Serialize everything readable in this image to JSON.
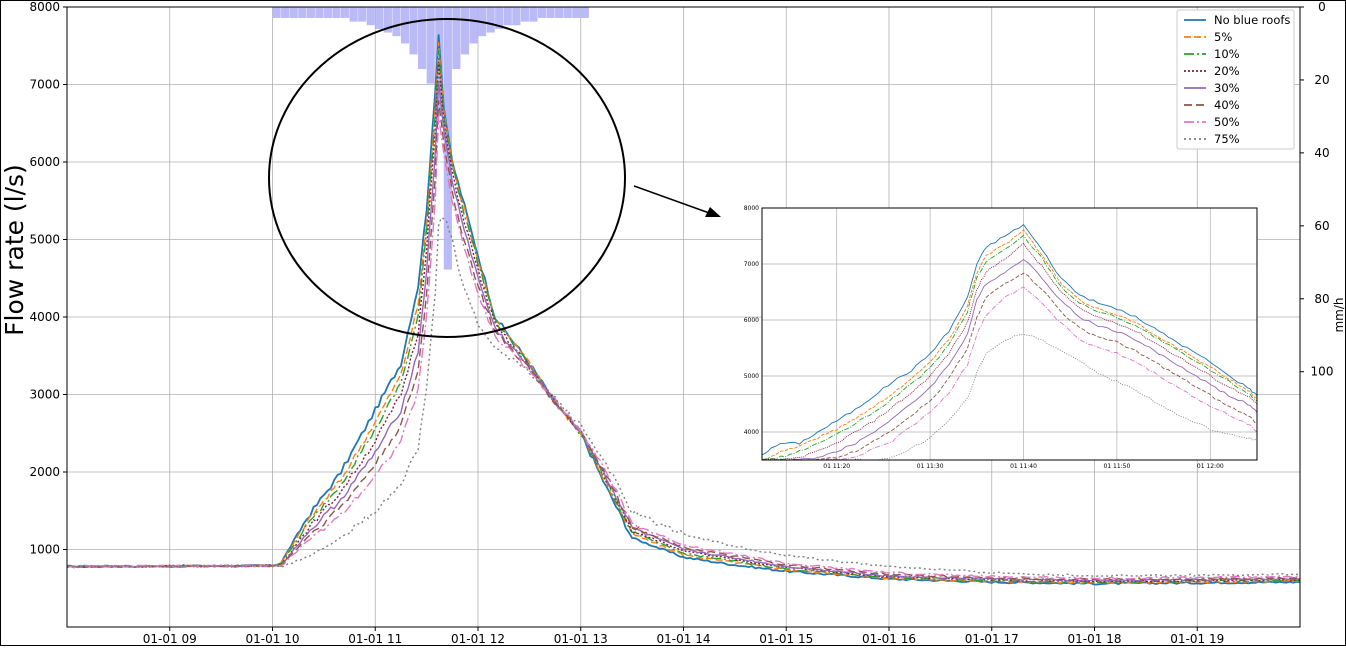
{
  "chart_data": [
    {
      "type": "line",
      "ylabel": "Flow rate (l/s)",
      "y2label": "mm/h",
      "ylim": [
        0,
        8000
      ],
      "xlim": [
        "01-01 08:00",
        "01-01 20:00"
      ],
      "x_ticks": [
        "01-01 09",
        "01-01 10",
        "01-01 11",
        "01-01 12",
        "01-01 13",
        "01-01 14",
        "01-01 15",
        "01-01 16",
        "01-01 17",
        "01-01 18",
        "01-01 19"
      ],
      "y_ticks": [
        1000,
        2000,
        3000,
        4000,
        5000,
        6000,
        7000,
        8000
      ],
      "y2_ticks": [
        0,
        20,
        40,
        60,
        80,
        100
      ],
      "y2lim": [
        0,
        170
      ],
      "y2_inverted": true,
      "grid": true,
      "legend_position": "top-right",
      "x": [
        "08:00",
        "10:00",
        "10:05",
        "10:20",
        "10:40",
        "11:00",
        "11:15",
        "11:25",
        "11:30",
        "11:35",
        "11:37",
        "11:40",
        "11:45",
        "11:50",
        "12:00",
        "12:10",
        "12:30",
        "12:45",
        "13:00",
        "13:15",
        "13:30",
        "14:00",
        "14:30",
        "15:00",
        "16:00",
        "17:00",
        "18:00",
        "19:00",
        "20:00"
      ],
      "series": [
        {
          "name": "No blue roofs",
          "color": "#1f77b4",
          "dash": "",
          "values": [
            780,
            790,
            830,
            1400,
            2000,
            2800,
            3400,
            4400,
            5400,
            6900,
            7650,
            6700,
            6000,
            5600,
            4800,
            4000,
            3400,
            2900,
            2500,
            1800,
            1150,
            900,
            800,
            720,
            620,
            580,
            560,
            570,
            580
          ]
        },
        {
          "name": "5%",
          "color": "#ff7f0e",
          "dash": "7,3",
          "values": [
            780,
            790,
            820,
            1350,
            1900,
            2650,
            3250,
            4150,
            5200,
            6700,
            7550,
            6650,
            6000,
            5550,
            4750,
            3970,
            3400,
            2900,
            2500,
            1850,
            1200,
            930,
            830,
            740,
            630,
            590,
            570,
            580,
            590
          ]
        },
        {
          "name": "10%",
          "color": "#2ca02c",
          "dash": "10,3,2,3",
          "values": [
            780,
            790,
            810,
            1300,
            1850,
            2550,
            3150,
            4000,
            5100,
            6600,
            7450,
            6600,
            5950,
            5500,
            4700,
            3950,
            3380,
            2900,
            2500,
            1870,
            1220,
            950,
            850,
            750,
            640,
            600,
            580,
            590,
            600
          ]
        },
        {
          "name": "20%",
          "color": "#8c1a3c",
          "dash": "2,2",
          "values": [
            780,
            790,
            800,
            1250,
            1750,
            2400,
            3000,
            3800,
            4900,
            6400,
            7300,
            6500,
            5850,
            5400,
            4600,
            3900,
            3350,
            2900,
            2520,
            1900,
            1250,
            980,
            870,
            770,
            650,
            610,
            590,
            600,
            610
          ]
        },
        {
          "name": "30%",
          "color": "#9467bd",
          "dash": "",
          "values": [
            780,
            790,
            795,
            1200,
            1650,
            2250,
            2800,
            3550,
            4600,
            6100,
            7050,
            6400,
            5750,
            5300,
            4500,
            3850,
            3350,
            2900,
            2520,
            1930,
            1280,
            1000,
            890,
            780,
            660,
            620,
            600,
            610,
            620
          ]
        },
        {
          "name": "40%",
          "color": "#8c564b",
          "dash": "8,4",
          "values": [
            780,
            790,
            790,
            1150,
            1550,
            2100,
            2600,
            3300,
            4300,
            5800,
            6800,
            6250,
            5600,
            5150,
            4400,
            3800,
            3330,
            2900,
            2530,
            1960,
            1300,
            1030,
            910,
            800,
            680,
            630,
            610,
            620,
            630
          ]
        },
        {
          "name": "50%",
          "color": "#e377c2",
          "dash": "10,3,2,3",
          "values": [
            780,
            790,
            785,
            1100,
            1450,
            1950,
            2400,
            3050,
            4000,
            5500,
            6600,
            6100,
            5500,
            5050,
            4300,
            3750,
            3320,
            2920,
            2550,
            2000,
            1330,
            1060,
            940,
            820,
            700,
            650,
            630,
            640,
            650
          ]
        },
        {
          "name": "75%",
          "color": "#7f7f7f",
          "dash": "2,3",
          "values": [
            780,
            790,
            780,
            900,
            1150,
            1500,
            1850,
            2300,
            3100,
            4300,
            5200,
            5300,
            5000,
            4500,
            3900,
            3600,
            3300,
            2950,
            2600,
            2100,
            1480,
            1200,
            1040,
            920,
            780,
            700,
            660,
            670,
            680
          ]
        }
      ],
      "rain_mm_h": {
        "x": [
          "10:00",
          "10:05",
          "10:10",
          "10:15",
          "10:20",
          "10:25",
          "10:30",
          "10:35",
          "10:40",
          "10:45",
          "10:50",
          "10:55",
          "11:00",
          "11:05",
          "11:10",
          "11:15",
          "11:20",
          "11:25",
          "11:30",
          "11:35",
          "11:40",
          "11:45",
          "11:50",
          "11:55",
          "12:00",
          "12:05",
          "12:10",
          "12:15",
          "12:20",
          "12:25",
          "12:30",
          "12:35",
          "12:40",
          "12:45",
          "12:50",
          "12:55",
          "13:00"
        ],
        "values": [
          3,
          3,
          3,
          3,
          3,
          3,
          3,
          3,
          3,
          4,
          4,
          5,
          6,
          7,
          8,
          10,
          13,
          17,
          21,
          30,
          72,
          17,
          13,
          10,
          8,
          7,
          6,
          5,
          5,
          4,
          4,
          3,
          3,
          3,
          3,
          3,
          3
        ]
      }
    },
    {
      "type": "line",
      "title": "",
      "xlim": [
        "11:12",
        "12:05"
      ],
      "ylim": [
        3500,
        8000
      ],
      "x_ticks": [
        "01 11:20",
        "01 11:30",
        "01 11:40",
        "01 11:50",
        "01 12:00"
      ],
      "y_ticks": [
        4000,
        5000,
        6000,
        7000,
        8000
      ],
      "grid": true,
      "x": [
        "11:12",
        "11:14",
        "11:16",
        "11:18",
        "11:20",
        "11:22",
        "11:24",
        "11:26",
        "11:28",
        "11:30",
        "11:32",
        "11:34",
        "11:35",
        "11:36",
        "11:38",
        "11:40",
        "11:42",
        "11:44",
        "11:46",
        "11:48",
        "11:50",
        "11:52",
        "11:54",
        "11:56",
        "11:58",
        "12:00",
        "12:02",
        "12:04",
        "12:05"
      ],
      "series": [
        {
          "name": "No blue roofs",
          "color": "#1f77b4",
          "dash": "",
          "values": [
            3600,
            3800,
            3800,
            4000,
            4200,
            4400,
            4650,
            4900,
            5100,
            5400,
            5800,
            6400,
            7000,
            7300,
            7500,
            7700,
            7250,
            6750,
            6450,
            6300,
            6200,
            6050,
            5850,
            5650,
            5450,
            5250,
            5000,
            4800,
            4650
          ]
        },
        {
          "name": "5%",
          "color": "#ff7f0e",
          "dash": "7,3",
          "values": [
            3500,
            3650,
            3750,
            3900,
            4050,
            4250,
            4450,
            4700,
            4950,
            5250,
            5650,
            6250,
            6850,
            7150,
            7350,
            7600,
            7150,
            6650,
            6350,
            6200,
            6100,
            5950,
            5750,
            5550,
            5350,
            5150,
            4950,
            4750,
            4600
          ]
        },
        {
          "name": "10%",
          "color": "#2ca02c",
          "dash": "10,3,2,3",
          "values": [
            3500,
            3550,
            3650,
            3800,
            3950,
            4150,
            4350,
            4600,
            4850,
            5150,
            5550,
            6150,
            6750,
            7050,
            7250,
            7500,
            7100,
            6600,
            6300,
            6150,
            6050,
            5900,
            5700,
            5500,
            5300,
            5100,
            4900,
            4700,
            4550
          ]
        },
        {
          "name": "20%",
          "color": "#8c1a3c",
          "dash": "2,2",
          "values": [
            3500,
            3500,
            3550,
            3650,
            3800,
            4000,
            4200,
            4450,
            4700,
            5000,
            5400,
            5950,
            6550,
            6850,
            7100,
            7350,
            6950,
            6500,
            6200,
            6050,
            5950,
            5800,
            5600,
            5400,
            5200,
            5000,
            4800,
            4650,
            4500
          ]
        },
        {
          "name": "30%",
          "color": "#9467bd",
          "dash": "",
          "values": [
            3500,
            3500,
            3500,
            3550,
            3650,
            3800,
            4000,
            4250,
            4500,
            4800,
            5200,
            5750,
            6350,
            6650,
            6850,
            7100,
            6750,
            6350,
            6050,
            5900,
            5800,
            5650,
            5450,
            5250,
            5050,
            4850,
            4650,
            4500,
            4350
          ]
        },
        {
          "name": "40%",
          "color": "#8c564b",
          "dash": "8,4",
          "values": [
            3500,
            3500,
            3500,
            3500,
            3550,
            3650,
            3850,
            4050,
            4300,
            4550,
            4950,
            5500,
            6050,
            6400,
            6650,
            6850,
            6550,
            6150,
            5850,
            5700,
            5600,
            5450,
            5250,
            5050,
            4850,
            4650,
            4450,
            4300,
            4150
          ]
        },
        {
          "name": "50%",
          "color": "#e377c2",
          "dash": "10,3,2,3",
          "values": [
            3500,
            3500,
            3500,
            3500,
            3500,
            3550,
            3700,
            3850,
            4100,
            4350,
            4700,
            5200,
            5750,
            6100,
            6400,
            6600,
            6300,
            5950,
            5650,
            5500,
            5400,
            5250,
            5050,
            4850,
            4650,
            4450,
            4300,
            4150,
            4000
          ]
        },
        {
          "name": "75%",
          "color": "#7f7f7f",
          "dash": "2,3",
          "values": [
            3500,
            3500,
            3500,
            3500,
            3500,
            3500,
            3500,
            3550,
            3700,
            3900,
            4200,
            4600,
            5050,
            5400,
            5650,
            5750,
            5650,
            5450,
            5250,
            5050,
            4900,
            4750,
            4550,
            4350,
            4200,
            4050,
            3950,
            3900,
            3850
          ]
        }
      ]
    }
  ]
}
